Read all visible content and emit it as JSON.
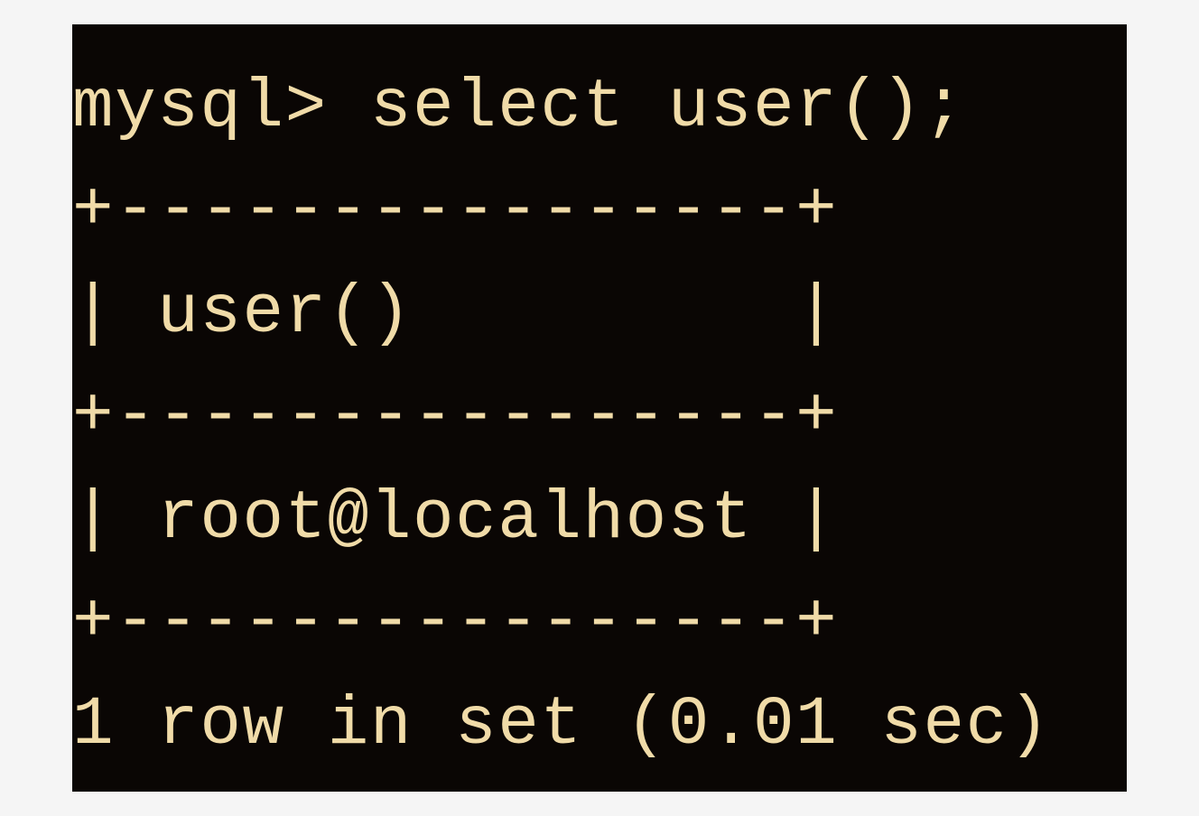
{
  "terminal": {
    "prompt": "mysql> ",
    "command": "select user();",
    "table_border": "+----------------+",
    "column_header": "| user()         |",
    "data_row": "| root@localhost |",
    "status": "1 row in set (0.01 sec)"
  }
}
